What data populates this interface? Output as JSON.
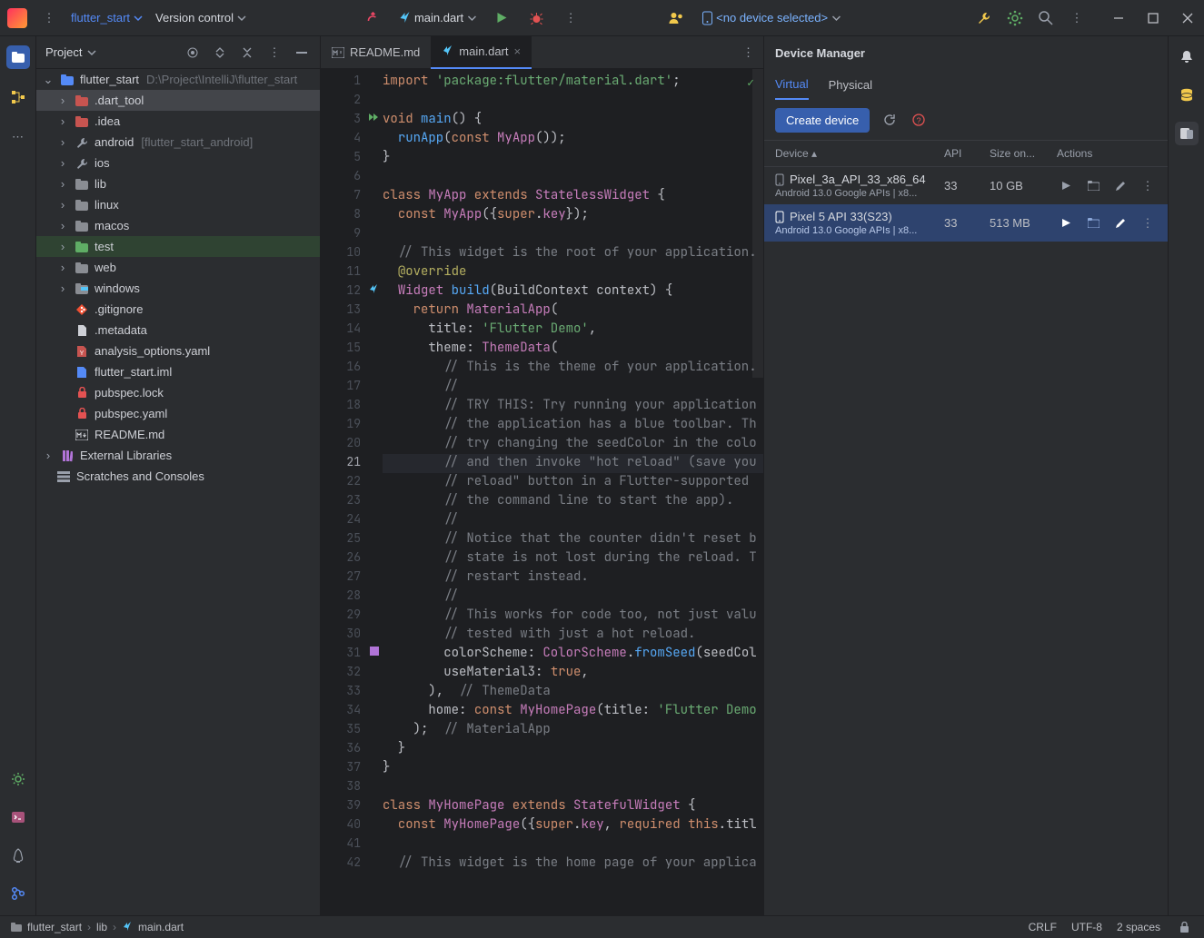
{
  "top": {
    "project": "flutter_start",
    "vcs": "Version control",
    "runconf": "main.dart",
    "device": "<no device selected>"
  },
  "sidebar": {
    "title": "Project"
  },
  "tree": {
    "root": "flutter_start",
    "root_path": "D:\\Project\\IntelliJ\\flutter_start",
    "items": [
      {
        "icon": "folder-red",
        "name": ".dart_tool",
        "sel": true
      },
      {
        "icon": "folder-red",
        "name": ".idea"
      },
      {
        "icon": "wrench",
        "name": "android",
        "extra": "[flutter_start_android]"
      },
      {
        "icon": "wrench",
        "name": "ios"
      },
      {
        "icon": "folder",
        "name": "lib"
      },
      {
        "icon": "folder",
        "name": "linux"
      },
      {
        "icon": "folder",
        "name": "macos"
      },
      {
        "icon": "folder-green",
        "name": "test",
        "hl": true
      },
      {
        "icon": "folder",
        "name": "web"
      },
      {
        "icon": "folder-win",
        "name": "windows"
      },
      {
        "icon": "git",
        "name": ".gitignore",
        "leaf": true
      },
      {
        "icon": "file",
        "name": ".metadata",
        "leaf": true
      },
      {
        "icon": "yaml",
        "name": "analysis_options.yaml",
        "leaf": true
      },
      {
        "icon": "iml",
        "name": "flutter_start.iml",
        "leaf": true
      },
      {
        "icon": "lock",
        "name": "pubspec.lock",
        "leaf": true
      },
      {
        "icon": "lock",
        "name": "pubspec.yaml",
        "leaf": true
      },
      {
        "icon": "md",
        "name": "README.md",
        "leaf": true
      }
    ],
    "ext": "External Libraries",
    "scratch": "Scratches and Consoles"
  },
  "tabs": [
    {
      "icon": "md",
      "name": "README.md"
    },
    {
      "icon": "flutter",
      "name": "main.dart",
      "active": true
    }
  ],
  "code": {
    "lines": [
      {
        "n": 1,
        "seg": [
          [
            "kw",
            "import "
          ],
          [
            "str",
            "'package:flutter/material.dart'"
          ],
          [
            "id",
            ";"
          ]
        ]
      },
      {
        "n": 2,
        "seg": []
      },
      {
        "n": 3,
        "seg": [
          [
            "kw",
            "void "
          ],
          [
            "fn",
            "main"
          ],
          [
            "id",
            "() {"
          ]
        ],
        "gicon": "run"
      },
      {
        "n": 4,
        "seg": [
          [
            "id",
            "  "
          ],
          [
            "fn",
            "runApp"
          ],
          [
            "id",
            "("
          ],
          [
            "kw",
            "const "
          ],
          [
            "typ",
            "MyApp"
          ],
          [
            "id",
            "());"
          ]
        ]
      },
      {
        "n": 5,
        "seg": [
          [
            "id",
            "}"
          ]
        ]
      },
      {
        "n": 6,
        "seg": []
      },
      {
        "n": 7,
        "seg": [
          [
            "kw",
            "class "
          ],
          [
            "typ",
            "MyApp"
          ],
          [
            "kw",
            " extends "
          ],
          [
            "typ",
            "StatelessWidget"
          ],
          [
            "id",
            " {"
          ]
        ]
      },
      {
        "n": 8,
        "seg": [
          [
            "id",
            "  "
          ],
          [
            "kw",
            "const "
          ],
          [
            "typ",
            "MyApp"
          ],
          [
            "id",
            "({"
          ],
          [
            "kw",
            "super"
          ],
          [
            "id",
            "."
          ],
          [
            "typ",
            "key"
          ],
          [
            "id",
            "});"
          ]
        ]
      },
      {
        "n": 9,
        "seg": []
      },
      {
        "n": 10,
        "seg": [
          [
            "id",
            "  "
          ],
          [
            "cmt",
            "// This widget is the root of your application."
          ]
        ]
      },
      {
        "n": 11,
        "seg": [
          [
            "id",
            "  "
          ],
          [
            "anno",
            "@override"
          ]
        ]
      },
      {
        "n": 12,
        "seg": [
          [
            "id",
            "  "
          ],
          [
            "typ",
            "Widget "
          ],
          [
            "fn",
            "build"
          ],
          [
            "id",
            "(BuildContext context) {"
          ]
        ],
        "gicon": "flutter"
      },
      {
        "n": 13,
        "seg": [
          [
            "id",
            "    "
          ],
          [
            "kw",
            "return "
          ],
          [
            "typ",
            "MaterialApp"
          ],
          [
            "id",
            "("
          ]
        ]
      },
      {
        "n": 14,
        "seg": [
          [
            "id",
            "      title: "
          ],
          [
            "str",
            "'Flutter Demo'"
          ],
          [
            "id",
            ","
          ]
        ]
      },
      {
        "n": 15,
        "seg": [
          [
            "id",
            "      theme: "
          ],
          [
            "typ",
            "ThemeData"
          ],
          [
            "id",
            "("
          ]
        ]
      },
      {
        "n": 16,
        "seg": [
          [
            "id",
            "        "
          ],
          [
            "cmt",
            "// This is the theme of your application."
          ]
        ]
      },
      {
        "n": 17,
        "seg": [
          [
            "id",
            "        "
          ],
          [
            "cmt",
            "//"
          ]
        ]
      },
      {
        "n": 18,
        "seg": [
          [
            "id",
            "        "
          ],
          [
            "cmt",
            "// TRY THIS: Try running your application"
          ]
        ]
      },
      {
        "n": 19,
        "seg": [
          [
            "id",
            "        "
          ],
          [
            "cmt",
            "// the application has a blue toolbar. Th"
          ]
        ]
      },
      {
        "n": 20,
        "seg": [
          [
            "id",
            "        "
          ],
          [
            "cmt",
            "// try changing the seedColor in the colo"
          ]
        ]
      },
      {
        "n": 21,
        "seg": [
          [
            "id",
            "        "
          ],
          [
            "cmt",
            "// and then invoke \"hot reload\" (save you"
          ]
        ],
        "curr": true
      },
      {
        "n": 22,
        "seg": [
          [
            "id",
            "        "
          ],
          [
            "cmt",
            "// reload\" button in a Flutter-supported "
          ]
        ]
      },
      {
        "n": 23,
        "seg": [
          [
            "id",
            "        "
          ],
          [
            "cmt",
            "// the command line to start the app)."
          ]
        ]
      },
      {
        "n": 24,
        "seg": [
          [
            "id",
            "        "
          ],
          [
            "cmt",
            "//"
          ]
        ]
      },
      {
        "n": 25,
        "seg": [
          [
            "id",
            "        "
          ],
          [
            "cmt",
            "// Notice that the counter didn't reset b"
          ]
        ]
      },
      {
        "n": 26,
        "seg": [
          [
            "id",
            "        "
          ],
          [
            "cmt",
            "// state is not lost during the reload. T"
          ]
        ]
      },
      {
        "n": 27,
        "seg": [
          [
            "id",
            "        "
          ],
          [
            "cmt",
            "// restart instead."
          ]
        ]
      },
      {
        "n": 28,
        "seg": [
          [
            "id",
            "        "
          ],
          [
            "cmt",
            "//"
          ]
        ]
      },
      {
        "n": 29,
        "seg": [
          [
            "id",
            "        "
          ],
          [
            "cmt",
            "// This works for code too, not just valu"
          ]
        ]
      },
      {
        "n": 30,
        "seg": [
          [
            "id",
            "        "
          ],
          [
            "cmt",
            "// tested with just a hot reload."
          ]
        ]
      },
      {
        "n": 31,
        "seg": [
          [
            "id",
            "        colorScheme: "
          ],
          [
            "typ",
            "ColorScheme"
          ],
          [
            "id",
            "."
          ],
          [
            "fn",
            "fromSeed"
          ],
          [
            "id",
            "(seedCol"
          ]
        ],
        "gicon": "swatch"
      },
      {
        "n": 32,
        "seg": [
          [
            "id",
            "        useMaterial3: "
          ],
          [
            "lit",
            "true"
          ],
          [
            "id",
            ","
          ]
        ]
      },
      {
        "n": 33,
        "seg": [
          [
            "id",
            "      ),  "
          ],
          [
            "cmt",
            "// ThemeData"
          ]
        ]
      },
      {
        "n": 34,
        "seg": [
          [
            "id",
            "      home: "
          ],
          [
            "kw",
            "const "
          ],
          [
            "typ",
            "MyHomePage"
          ],
          [
            "id",
            "(title: "
          ],
          [
            "str",
            "'Flutter Demo"
          ]
        ]
      },
      {
        "n": 35,
        "seg": [
          [
            "id",
            "    );  "
          ],
          [
            "cmt",
            "// MaterialApp"
          ]
        ]
      },
      {
        "n": 36,
        "seg": [
          [
            "id",
            "  }"
          ]
        ]
      },
      {
        "n": 37,
        "seg": [
          [
            "id",
            "}"
          ]
        ]
      },
      {
        "n": 38,
        "seg": []
      },
      {
        "n": 39,
        "seg": [
          [
            "kw",
            "class "
          ],
          [
            "typ",
            "MyHomePage"
          ],
          [
            "kw",
            " extends "
          ],
          [
            "typ",
            "StatefulWidget"
          ],
          [
            "id",
            " {"
          ]
        ]
      },
      {
        "n": 40,
        "seg": [
          [
            "id",
            "  "
          ],
          [
            "kw",
            "const "
          ],
          [
            "typ",
            "MyHomePage"
          ],
          [
            "id",
            "({"
          ],
          [
            "kw",
            "super"
          ],
          [
            "id",
            "."
          ],
          [
            "typ",
            "key"
          ],
          [
            "id",
            ", "
          ],
          [
            "kw",
            "required "
          ],
          [
            "kw",
            "this"
          ],
          [
            "id",
            ".titl"
          ]
        ]
      },
      {
        "n": 41,
        "seg": []
      },
      {
        "n": 42,
        "seg": [
          [
            "id",
            "  "
          ],
          [
            "cmt",
            "// This widget is the home page of your applica"
          ]
        ]
      }
    ]
  },
  "devmgr": {
    "title": "Device Manager",
    "tabs": [
      "Virtual",
      "Physical"
    ],
    "create": "Create device",
    "cols": [
      "Device ▴",
      "API",
      "Size on...",
      "Actions"
    ],
    "rows": [
      {
        "name": "Pixel_3a_API_33_x86_64",
        "sub": "Android 13.0 Google APIs | x8...",
        "api": "33",
        "size": "10 GB"
      },
      {
        "name": "Pixel 5 API 33(S23)",
        "sub": "Android 13.0 Google APIs | x8...",
        "api": "33",
        "size": "513 MB",
        "sel": true
      }
    ]
  },
  "status": {
    "crumbs": [
      "flutter_start",
      "lib",
      "main.dart"
    ],
    "right": [
      "CRLF",
      "UTF-8",
      "2 spaces"
    ]
  }
}
